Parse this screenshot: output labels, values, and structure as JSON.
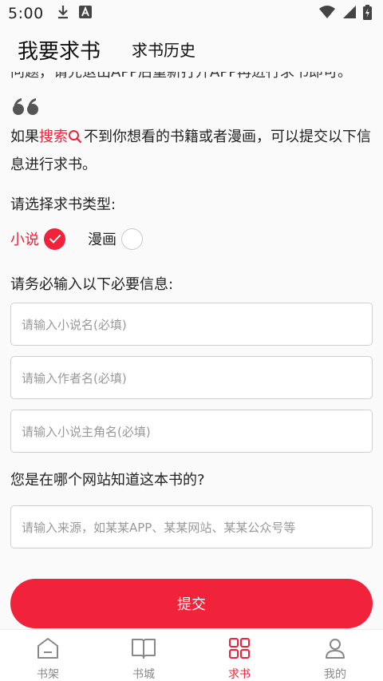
{
  "status_bar": {
    "time": "5:00"
  },
  "header": {
    "tab_main": "我要求书",
    "tab_history": "求书历史"
  },
  "notice": {
    "cut_line": "问题，请先退出APP后重新打开APP再进行求书即可。"
  },
  "intro": {
    "prefix": "如果",
    "search_word": "搜索",
    "suffix": "不到你想看的书籍或者漫画，可以提交以下信息进行求书。"
  },
  "type_section": {
    "label": "请选择求书类型:",
    "options": [
      {
        "label": "小说",
        "selected": true
      },
      {
        "label": "漫画",
        "selected": false
      }
    ]
  },
  "required_section": {
    "label": "请务必输入以下必要信息:"
  },
  "inputs": {
    "novel_name_placeholder": "请输入小说名(必填)",
    "author_placeholder": "请输入作者名(必填)",
    "protagonist_placeholder": "请输入小说主角名(必填)",
    "source_placeholder": "请输入来源，如某某APP、某某网站、某某公众号等"
  },
  "source_section": {
    "label": "您是在哪个网站知道这本书的?"
  },
  "submit_label": "提交",
  "bottom_nav": [
    {
      "label": "书架",
      "icon": "bookshelf-icon",
      "active": false
    },
    {
      "label": "书城",
      "icon": "book-city-icon",
      "active": false
    },
    {
      "label": "求书",
      "icon": "request-book-icon",
      "active": true
    },
    {
      "label": "我的",
      "icon": "profile-icon",
      "active": false
    }
  ],
  "colors": {
    "accent": "#f0233a",
    "background": "#fafafa",
    "muted": "#888888"
  }
}
